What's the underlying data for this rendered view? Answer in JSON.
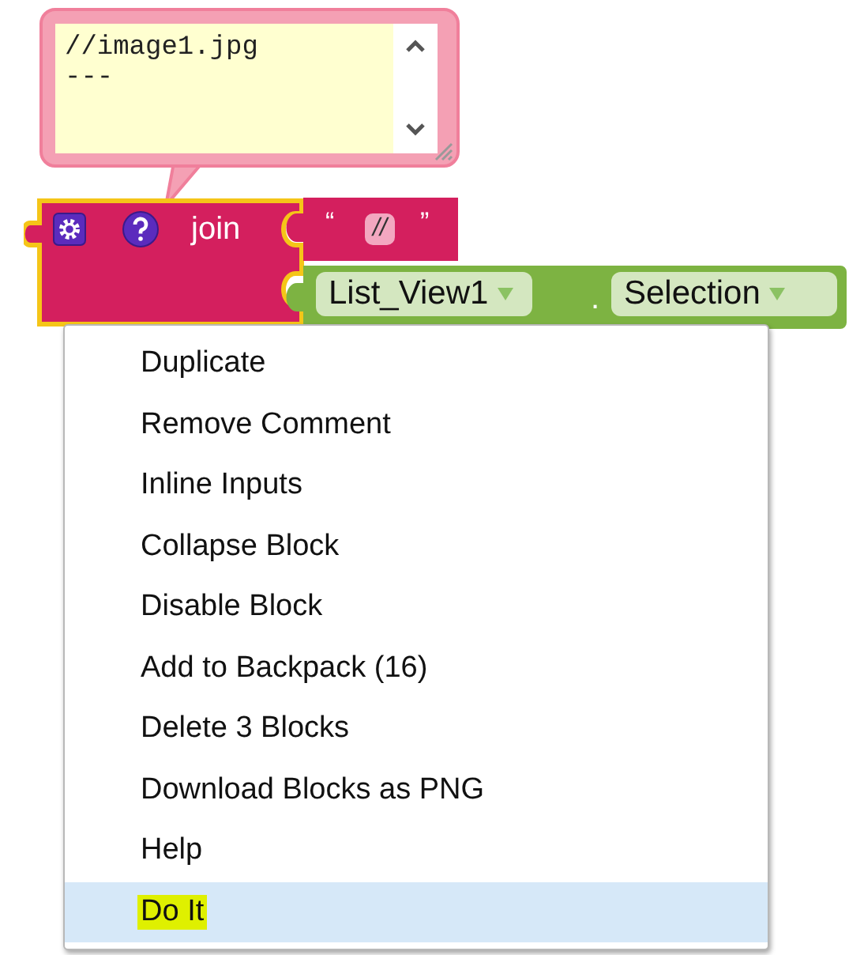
{
  "comment": {
    "lines": [
      "//image1.jpg",
      "---"
    ]
  },
  "join_block": {
    "label": "join",
    "selected": true
  },
  "text_block": {
    "open_quote": "“",
    "value": "//",
    "close_quote": "”"
  },
  "getter_block": {
    "component": "List_View1",
    "dot": ".",
    "property": "Selection"
  },
  "context_menu": {
    "items": [
      {
        "label": "Duplicate",
        "selected": false,
        "marked": false
      },
      {
        "label": "Remove Comment",
        "selected": false,
        "marked": false
      },
      {
        "label": "Inline Inputs",
        "selected": false,
        "marked": false
      },
      {
        "label": "Collapse Block",
        "selected": false,
        "marked": false
      },
      {
        "label": "Disable Block",
        "selected": false,
        "marked": false
      },
      {
        "label": "Add to Backpack (16)",
        "selected": false,
        "marked": false
      },
      {
        "label": "Delete 3 Blocks",
        "selected": false,
        "marked": false
      },
      {
        "label": "Download Blocks as PNG",
        "selected": false,
        "marked": false
      },
      {
        "label": "Help",
        "selected": false,
        "marked": false
      },
      {
        "label": "Do It",
        "selected": true,
        "marked": true
      }
    ]
  }
}
